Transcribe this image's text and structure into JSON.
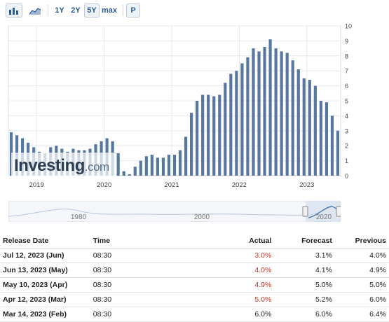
{
  "toolbar": {
    "buttons": [
      "1Y",
      "2Y",
      "5Y",
      "max"
    ],
    "active": "5Y",
    "p_label": "P"
  },
  "colors": {
    "bar": "#5577a0",
    "bar_faded": "#a9bdd4",
    "accent": "#2d5a94",
    "negative": "#c0392b"
  },
  "chart_data": {
    "type": "bar",
    "y_axis_ticks": [
      "0",
      "1",
      "2",
      "3",
      "4",
      "5",
      "6",
      "7",
      "8",
      "9",
      "10"
    ],
    "ylim": [
      0,
      10
    ],
    "x_tick_labels": [
      "2019",
      "2020",
      "2021",
      "2022",
      "2023"
    ],
    "watermark": "Investing.com",
    "months": [
      "2018-08",
      "2018-09",
      "2018-10",
      "2018-11",
      "2018-12",
      "2019-01",
      "2019-02",
      "2019-03",
      "2019-04",
      "2019-05",
      "2019-06",
      "2019-07",
      "2019-08",
      "2019-09",
      "2019-10",
      "2019-11",
      "2019-12",
      "2020-01",
      "2020-02",
      "2020-03",
      "2020-04",
      "2020-05",
      "2020-06",
      "2020-07",
      "2020-08",
      "2020-09",
      "2020-10",
      "2020-11",
      "2020-12",
      "2021-01",
      "2021-02",
      "2021-03",
      "2021-04",
      "2021-05",
      "2021-06",
      "2021-07",
      "2021-08",
      "2021-09",
      "2021-10",
      "2021-11",
      "2021-12",
      "2022-01",
      "2022-02",
      "2022-03",
      "2022-04",
      "2022-05",
      "2022-06",
      "2022-07",
      "2022-08",
      "2022-09",
      "2022-10",
      "2022-11",
      "2022-12",
      "2023-01",
      "2023-02",
      "2023-03",
      "2023-04",
      "2023-05",
      "2023-06"
    ],
    "values": [
      2.9,
      2.7,
      2.5,
      2.2,
      1.9,
      1.6,
      1.5,
      1.9,
      2.0,
      1.8,
      1.6,
      1.8,
      1.7,
      1.7,
      1.8,
      2.1,
      2.3,
      2.5,
      2.3,
      1.5,
      0.3,
      0.1,
      0.6,
      1.0,
      1.3,
      1.4,
      1.2,
      1.2,
      1.4,
      1.4,
      1.7,
      2.6,
      4.2,
      5.0,
      5.4,
      5.4,
      5.3,
      5.4,
      6.2,
      6.8,
      7.0,
      7.5,
      7.9,
      8.5,
      8.3,
      8.6,
      9.1,
      8.5,
      8.3,
      8.2,
      7.7,
      7.1,
      6.5,
      6.4,
      6.0,
      5.0,
      4.9,
      4.0,
      3.0
    ]
  },
  "navigator": {
    "labels": [
      "1980",
      "2000",
      "2020"
    ]
  },
  "table": {
    "headers": [
      "Release Date",
      "Time",
      "Actual",
      "Forecast",
      "Previous"
    ],
    "rows": [
      {
        "date": "Jul 12, 2023 (Jun)",
        "time": "08:30",
        "actual": "3.0%",
        "forecast": "3.1%",
        "previous": "4.0%",
        "actual_color": "negative"
      },
      {
        "date": "Jun 13, 2023 (May)",
        "time": "08:30",
        "actual": "4.0%",
        "forecast": "4.1%",
        "previous": "4.9%",
        "actual_color": "negative"
      },
      {
        "date": "May 10, 2023 (Apr)",
        "time": "08:30",
        "actual": "4.9%",
        "forecast": "5.0%",
        "previous": "5.0%",
        "actual_color": "negative"
      },
      {
        "date": "Apr 12, 2023 (Mar)",
        "time": "08:30",
        "actual": "5.0%",
        "forecast": "5.2%",
        "previous": "6.0%",
        "actual_color": "negative"
      },
      {
        "date": "Mar 14, 2023 (Feb)",
        "time": "08:30",
        "actual": "6.0%",
        "forecast": "6.0%",
        "previous": "6.4%",
        "actual_color": "neutral"
      }
    ]
  }
}
